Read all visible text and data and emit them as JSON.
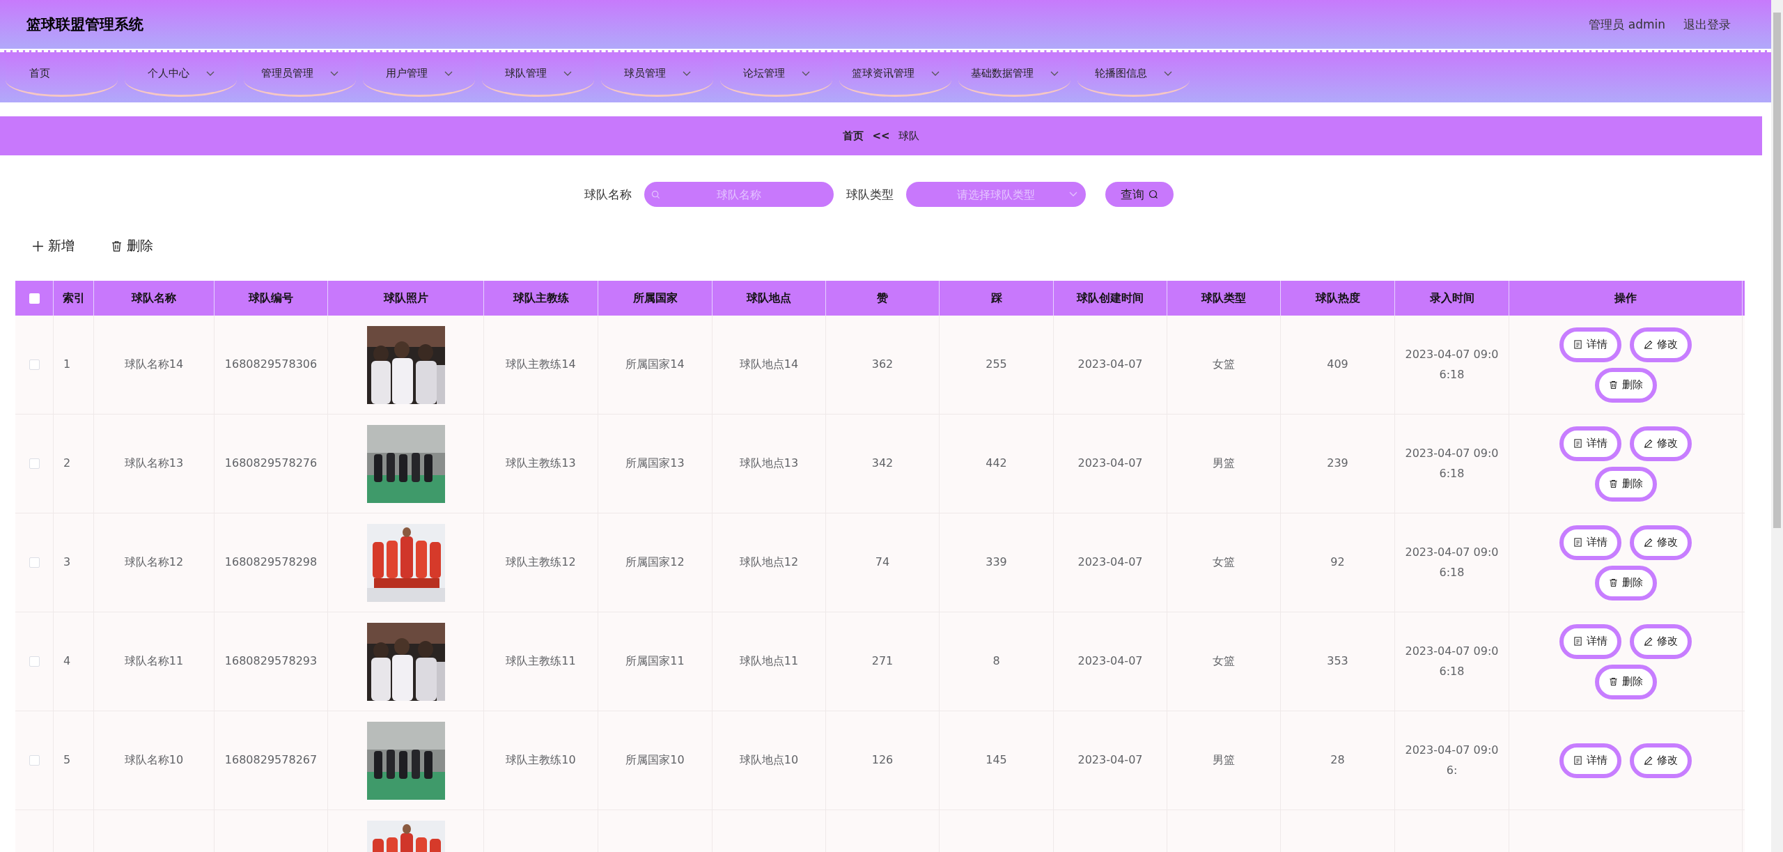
{
  "header": {
    "title": "篮球联盟管理系统",
    "user": "管理员 admin",
    "logout": "退出登录"
  },
  "nav": [
    {
      "label": "首页",
      "dropdown": false
    },
    {
      "label": "个人中心",
      "dropdown": true
    },
    {
      "label": "管理员管理",
      "dropdown": true
    },
    {
      "label": "用户管理",
      "dropdown": true
    },
    {
      "label": "球队管理",
      "dropdown": true
    },
    {
      "label": "球员管理",
      "dropdown": true
    },
    {
      "label": "论坛管理",
      "dropdown": true
    },
    {
      "label": "篮球资讯管理",
      "dropdown": true
    },
    {
      "label": "基础数据管理",
      "dropdown": true
    },
    {
      "label": "轮播图信息",
      "dropdown": true
    }
  ],
  "breadcrumb": {
    "home": "首页",
    "separator": "<<",
    "current": "球队"
  },
  "search": {
    "name_label": "球队名称",
    "name_placeholder": "球队名称",
    "type_label": "球队类型",
    "type_placeholder": "请选择球队类型",
    "button": "查询"
  },
  "toolbar": {
    "add": "新增",
    "delete": "删除"
  },
  "table": {
    "header_checked": false,
    "columns": [
      "索引",
      "球队名称",
      "球队编号",
      "球队照片",
      "球队主教练",
      "所属国家",
      "球队地点",
      "赞",
      "踩",
      "球队创建时间",
      "球队类型",
      "球队热度",
      "录入时间",
      "操作"
    ],
    "rows": [
      {
        "checked": false,
        "cells": [
          "1",
          "球队名称14",
          "1680829578306",
          {
            "kind": "picture"
          },
          "球队主教练14",
          "所属国家14",
          "球队地点14",
          "362",
          "255",
          "2023-04-07",
          "女篮",
          "409",
          "2023-04-07 09:06:18"
        ],
        "actions": [
          {
            "kind": "detail",
            "label": "详情"
          },
          {
            "kind": "edit",
            "label": "修改"
          },
          {
            "kind": "delete",
            "label": "删除"
          }
        ]
      },
      {
        "checked": false,
        "cells": [
          "2",
          "球队名称13",
          "1680829578276",
          {
            "kind": "picture"
          },
          "球队主教练13",
          "所属国家13",
          "球队地点13",
          "342",
          "442",
          "2023-04-07",
          "男篮",
          "239",
          "2023-04-07 09:06:18"
        ],
        "actions": [
          {
            "kind": "detail",
            "label": "详情"
          },
          {
            "kind": "edit",
            "label": "修改"
          },
          {
            "kind": "delete",
            "label": "删除"
          }
        ]
      },
      {
        "checked": false,
        "cells": [
          "3",
          "球队名称12",
          "1680829578298",
          {
            "kind": "picture"
          },
          "球队主教练12",
          "所属国家12",
          "球队地点12",
          "74",
          "339",
          "2023-04-07",
          "女篮",
          "92",
          "2023-04-07 09:06:18"
        ],
        "actions": [
          {
            "kind": "detail",
            "label": "详情"
          },
          {
            "kind": "edit",
            "label": "修改"
          },
          {
            "kind": "delete",
            "label": "删除"
          }
        ]
      },
      {
        "checked": false,
        "cells": [
          "4",
          "球队名称11",
          "1680829578293",
          {
            "kind": "picture"
          },
          "球队主教练11",
          "所属国家11",
          "球队地点11",
          "271",
          "8",
          "2023-04-07",
          "女篮",
          "353",
          "2023-04-07 09:06:18"
        ],
        "actions": [
          {
            "kind": "detail",
            "label": "详情"
          },
          {
            "kind": "edit",
            "label": "修改"
          },
          {
            "kind": "delete",
            "label": "删除"
          }
        ]
      },
      {
        "checked": false,
        "cells": [
          "5",
          "球队名称10",
          "1680829578267",
          {
            "kind": "picture"
          },
          "球队主教练10",
          "所属国家10",
          "球队地点10",
          "126",
          "145",
          "2023-04-07",
          "男篮",
          "28",
          "2023-04-07 09:06:"
        ],
        "actions": [
          {
            "kind": "detail",
            "label": "详情"
          },
          {
            "kind": "edit",
            "label": "修改"
          }
        ]
      },
      {
        "cells": [
          "",
          "",
          "",
          {
            "kind": "picture"
          },
          "",
          "",
          "",
          "",
          "",
          "",
          "",
          "",
          ""
        ],
        "actions": []
      }
    ]
  }
}
